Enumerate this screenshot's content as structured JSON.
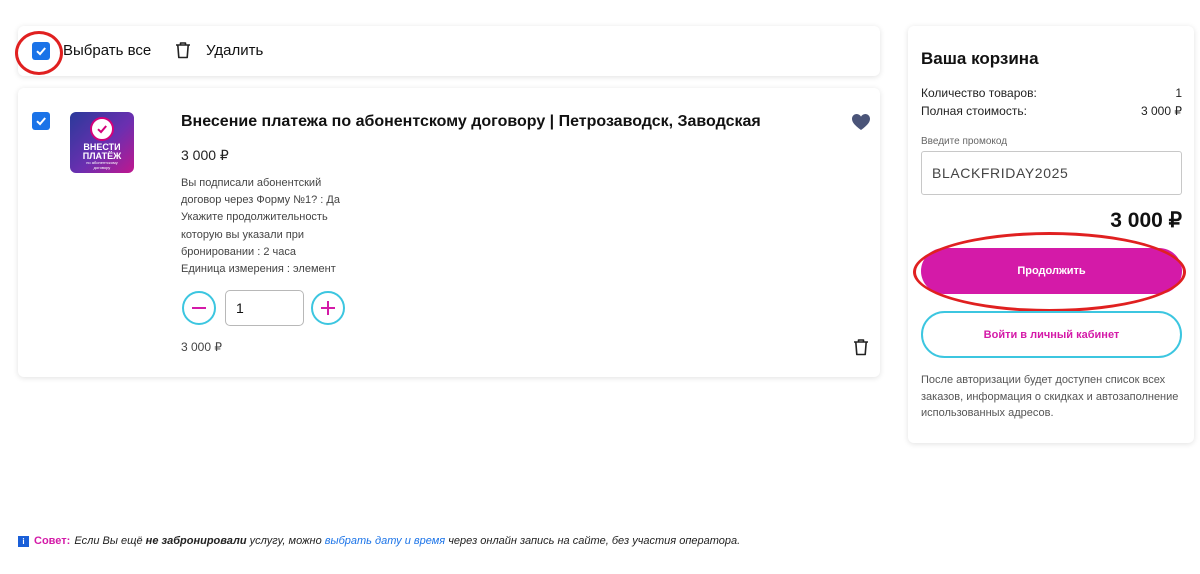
{
  "toolbar": {
    "select_all_label": "Выбрать все",
    "select_all_checked": true,
    "delete_label": "Удалить"
  },
  "item": {
    "checked": true,
    "thumbnail": {
      "line1": "ВНЕСТИ",
      "line2": "ПЛАТЁЖ",
      "line3": "по абонентскому",
      "line4": "договору"
    },
    "title": "Внесение платежа по абонентскому договору | Петрозаводск, Заводская",
    "price": "3 000 ₽",
    "description": [
      "Вы подписали абонентский",
      "договор через Форму №1? : Да",
      "Укажите продолжительность",
      "которую вы указали при",
      "бронировании : 2 часа",
      "Единица измерения : элемент"
    ],
    "quantity": "1",
    "subtotal": "3 000 ₽"
  },
  "cart": {
    "title": "Ваша корзина",
    "count_label": "Количество товаров:",
    "count_value": "1",
    "cost_label": "Полная стоимость:",
    "cost_value": "3 000 ₽",
    "promo_label": "Введите промокод",
    "promo_value": "BLACKFRIDAY2025",
    "total": "3 000 ₽",
    "continue_label": "Продолжить",
    "login_label": "Войти в личный кабинет",
    "note": "После авторизации будет доступен список всех заказов, информация о скидках и автозаполнение использованных адресов."
  },
  "tip": {
    "icon": "i",
    "label": "Совет:",
    "text1": "Если Вы ещё ",
    "bold": "не забронировали",
    "text2": " услугу, можно ",
    "link": "выбрать дату и время",
    "text3": " через онлайн запись на сайте, без участия оператора."
  },
  "colors": {
    "accent_magenta": "#d41aa8",
    "accent_cyan": "#3cc6e0",
    "checkbox_blue": "#1a73e8",
    "annotation_red": "#e02020"
  },
  "icons": [
    "check-icon",
    "trash-icon",
    "heart-icon",
    "minus-icon",
    "plus-icon",
    "info-icon"
  ]
}
